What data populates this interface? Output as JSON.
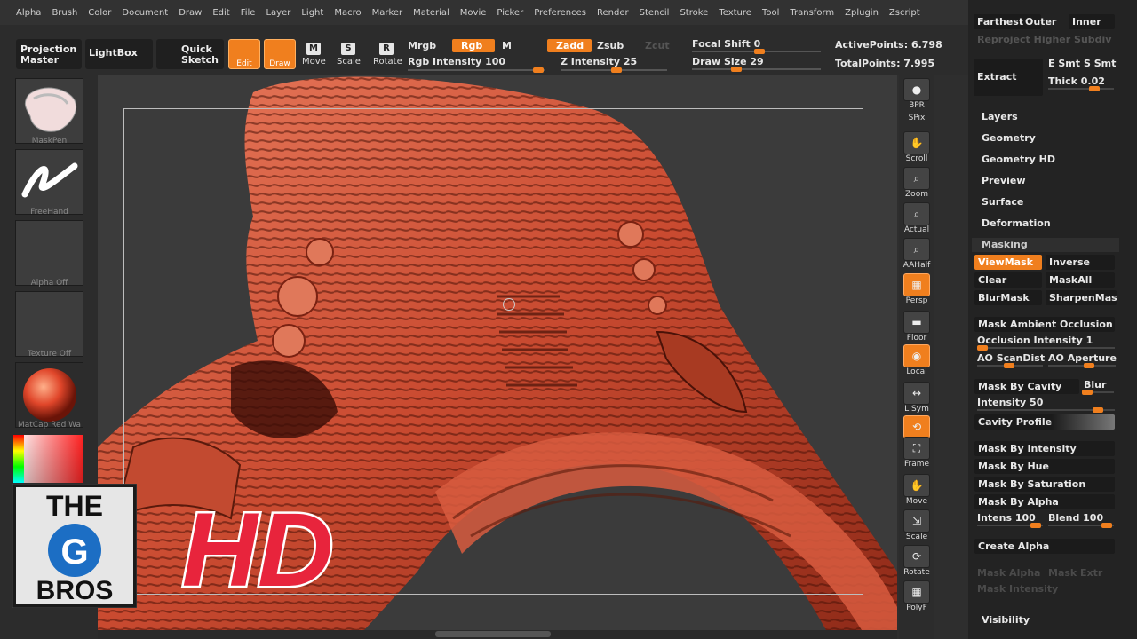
{
  "menu": [
    "Alpha",
    "Brush",
    "Color",
    "Document",
    "Draw",
    "Edit",
    "File",
    "Layer",
    "Light",
    "Macro",
    "Marker",
    "Material",
    "Movie",
    "Picker",
    "Preferences",
    "Render",
    "Stencil",
    "Stroke",
    "Texture",
    "Tool",
    "Transform",
    "Zplugin",
    "Zscript"
  ],
  "toolbar": {
    "projection_master": "Projection Master",
    "lightbox": "LightBox",
    "quick_sketch": "Quick Sketch",
    "edit": "Edit",
    "draw": "Draw",
    "move": "Move",
    "scale": "Scale",
    "rotate": "Rotate",
    "mrgb": "Mrgb",
    "rgb": "Rgb",
    "m": "M",
    "rgb_intensity": "Rgb Intensity 100",
    "zadd": "Zadd",
    "zsub": "Zsub",
    "zcut": "Zcut",
    "z_intensity": "Z Intensity 25",
    "focal_shift": "Focal Shift 0",
    "draw_size": "Draw Size 29",
    "active_points": "ActivePoints: 6.798",
    "total_points": "TotalPoints: 7.995"
  },
  "leftshelf": {
    "brush_label": "MaskPen",
    "stroke_label": "FreeHand",
    "alpha_label": "Alpha Off",
    "texture_label": "Texture Off",
    "material_label": "MatCap Red Wa"
  },
  "rightshelf": [
    "BPR",
    "SPix",
    "Scroll",
    "Zoom",
    "Actual",
    "AAHalf",
    "Persp",
    "Floor",
    "Local",
    "L.Sym",
    "Xyz",
    "Frame",
    "Move",
    "Scale",
    "Rotate",
    "PolyF"
  ],
  "palette": {
    "top_row1": [
      "Farthest",
      "Outer",
      "Inner"
    ],
    "reproject": "Reproject Higher Subdiv",
    "extract": "Extract",
    "e_smt": "E Smt",
    "s_smt": "S Smt",
    "thick": "Thick 0.02",
    "sections": [
      "Layers",
      "Geometry",
      "Geometry HD",
      "Preview",
      "Surface",
      "Deformation"
    ],
    "masking_header": "Masking",
    "viewmask": "ViewMask",
    "inverse": "Inverse",
    "clear": "Clear",
    "maskall": "MaskAll",
    "blurmask": "BlurMask",
    "sharpenmask": "SharpenMask",
    "mask_ao": "Mask Ambient Occlusion",
    "occlusion_intensity": "Occlusion Intensity 1",
    "ao_scandist": "AO ScanDist",
    "ao_aperture": "AO Aperture",
    "mask_by_cavity": "Mask By Cavity",
    "blur": "Blur",
    "intensity": "Intensity 50",
    "cavity_profile": "Cavity Profile",
    "mask_by_intensity": "Mask By Intensity",
    "mask_by_hue": "Mask By Hue",
    "mask_by_saturation": "Mask By Saturation",
    "mask_by_alpha": "Mask By Alpha",
    "intens": "Intens 100",
    "blend": "Blend 100",
    "create_alpha": "Create Alpha",
    "mask_alpha": "Mask Alpha",
    "mask_extr": "Mask Extr",
    "mask_intensity": "Mask Intensity",
    "visibility": "Visibility"
  },
  "logo": {
    "line1": "THE",
    "line2": "G",
    "line3": "BROS",
    "hd": "HD"
  },
  "colors": {
    "accent": "#f07f1e",
    "model": "#d65a3c"
  }
}
